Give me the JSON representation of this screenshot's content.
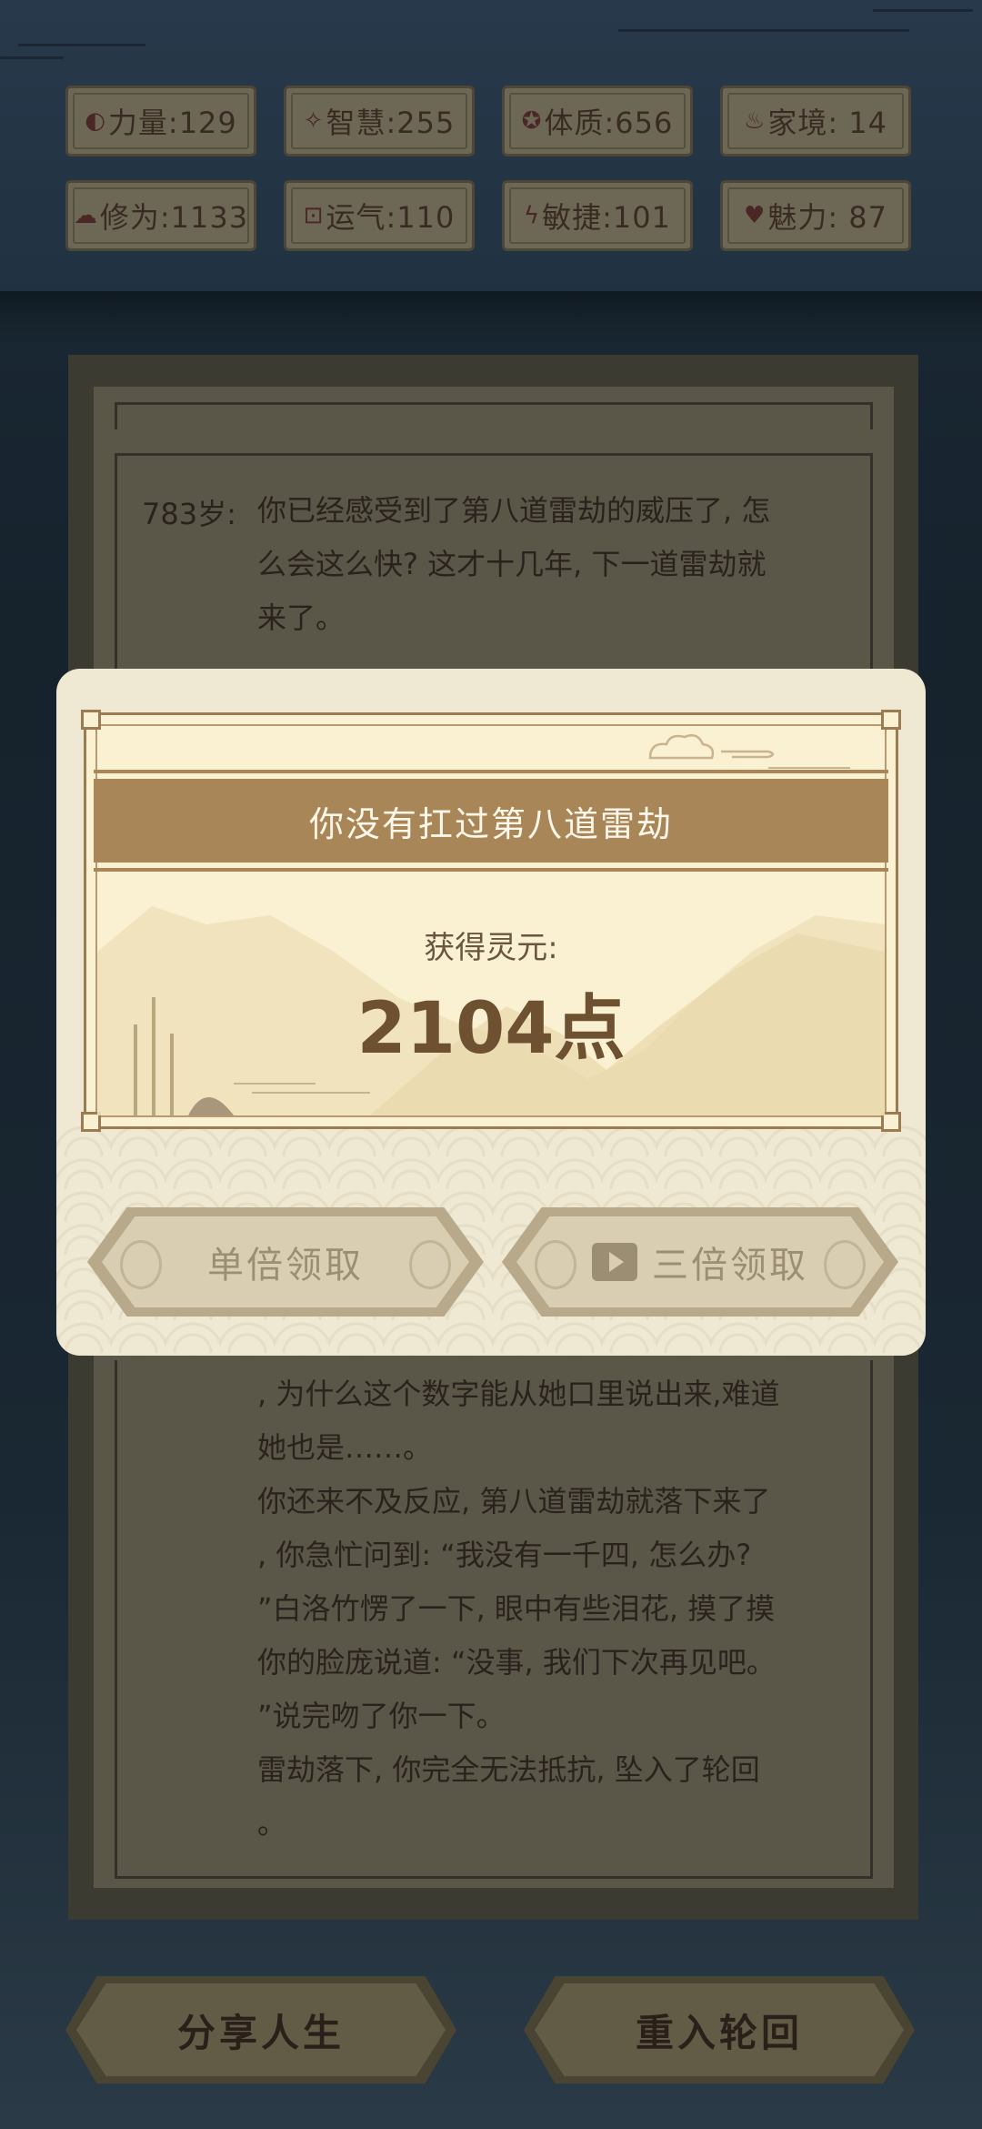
{
  "stats": [
    {
      "icon": "strength-icon",
      "glyph": "◐",
      "label": "力量:129"
    },
    {
      "icon": "wisdom-icon",
      "glyph": "✧",
      "label": "智慧:255"
    },
    {
      "icon": "constitution-icon",
      "glyph": "✪",
      "label": "体质:656"
    },
    {
      "icon": "family-icon",
      "glyph": "♨",
      "label": "家境: 14"
    },
    {
      "icon": "cultivation-icon",
      "glyph": "☁",
      "label": "修为:1133"
    },
    {
      "icon": "luck-icon",
      "glyph": "⊡",
      "label": "运气:110"
    },
    {
      "icon": "agility-icon",
      "glyph": "ϟ",
      "label": "敏捷:101"
    },
    {
      "icon": "charm-icon",
      "glyph": "♥",
      "label": "魅力: 87"
    }
  ],
  "story": {
    "age_label": "783岁:",
    "top_lines": [
      "你已经感受到了第八道雷劫的威压了, 怎",
      "么会这么快? 这才十几年, 下一道雷劫就",
      "来了。"
    ],
    "bottom_lines": [
      ", 为什么这个数字能从她口里说出来,难道",
      "她也是……。",
      "你还来不及反应, 第八道雷劫就落下来了",
      ", 你急忙问到: “我没有一千四, 怎么办?",
      "”白洛竹愣了一下, 眼中有些泪花, 摸了摸",
      "你的脸庞说道: “没事, 我们下次再见吧。",
      "”说完吻了你一下。",
      "雷劫落下, 你完全无法抵抗, 坠入了轮回",
      "。"
    ]
  },
  "modal": {
    "title": "你没有扛过第八道雷劫",
    "reward_label": "获得灵元:",
    "reward_value": "2104点",
    "single_claim": "单倍领取",
    "triple_claim": "三倍领取"
  },
  "bottom": {
    "share": "分享人生",
    "restart": "重入轮回"
  }
}
